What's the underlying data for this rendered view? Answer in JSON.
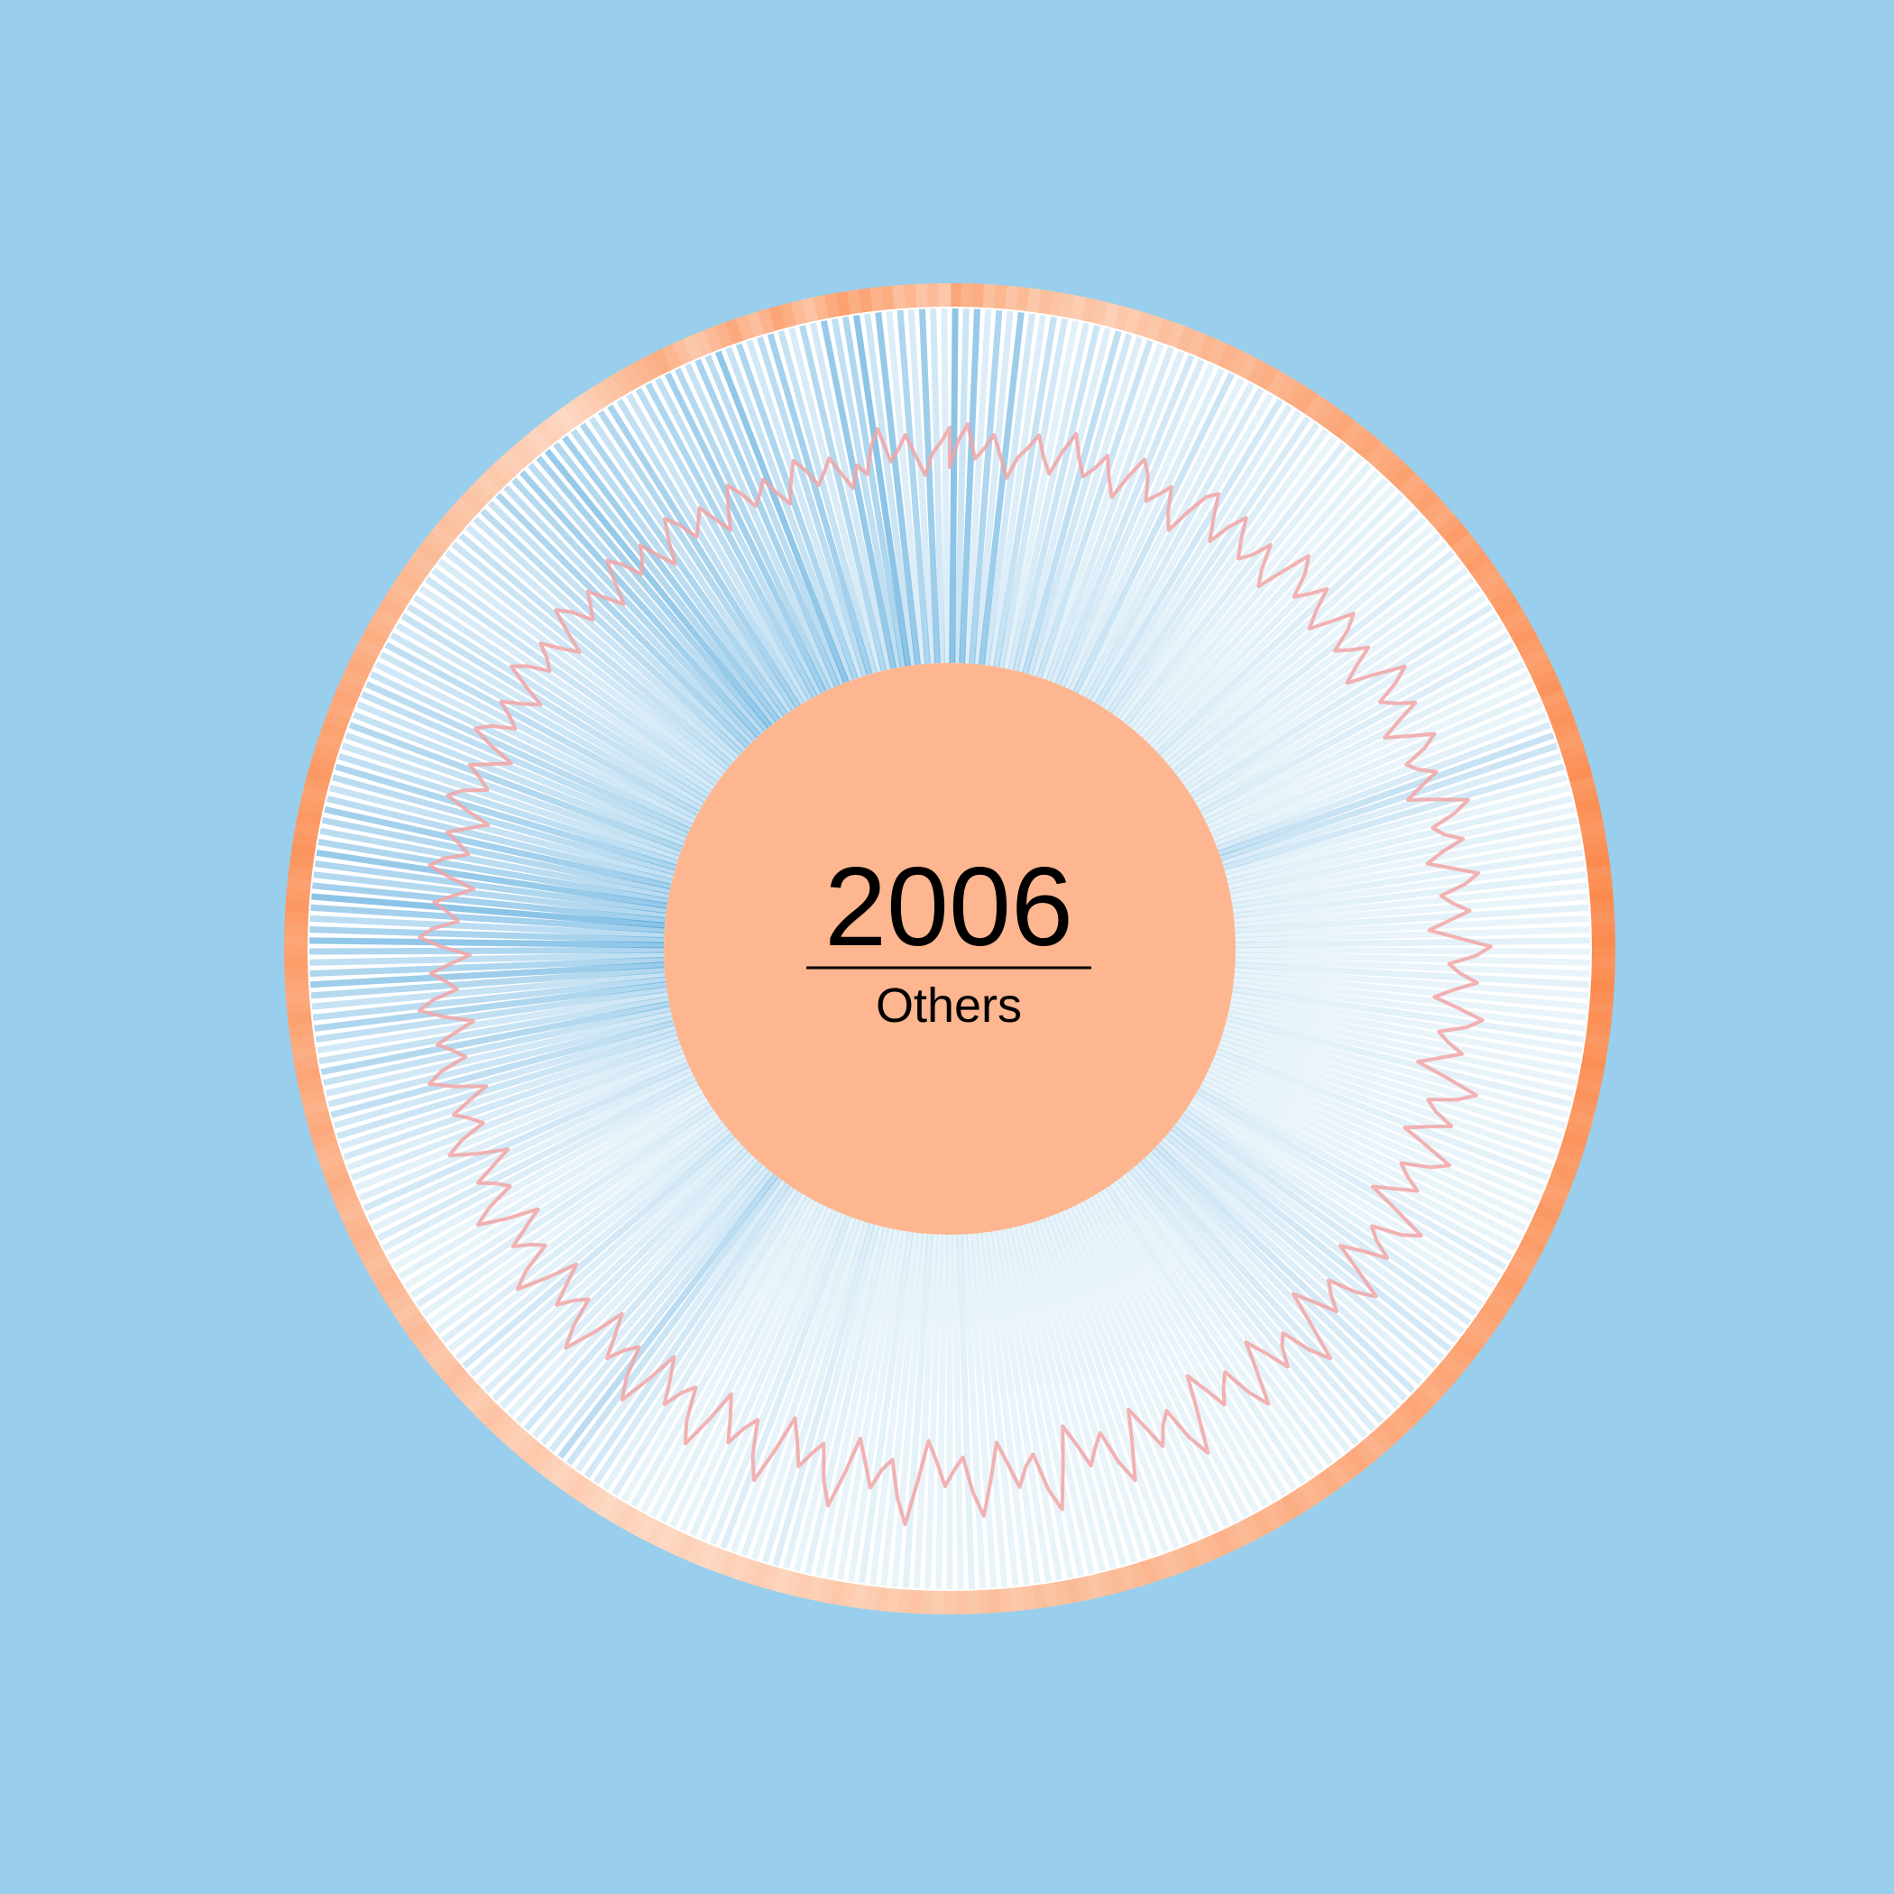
{
  "center": {
    "year": "2006",
    "category": "Others"
  },
  "colors": {
    "background": "#99cfec",
    "disc": "#ffffff",
    "center_disc": "#fdb68f",
    "outer_ring_light": "#fde2d1",
    "outer_ring_dark": "#fb8b4f",
    "spoke": "#3b9bd6",
    "line": "#f2a5a5"
  },
  "chart_data": {
    "type": "radial",
    "period_count": 365,
    "series": [
      {
        "mark": "line",
        "description_values_relative": true,
        "values": [
          0.47,
          0.62,
          0.71,
          0.52,
          0.58,
          0.66,
          0.54,
          0.43,
          0.55,
          0.61,
          0.69,
          0.57,
          0.49,
          0.63,
          0.74,
          0.61,
          0.52,
          0.58,
          0.67,
          0.55,
          0.46,
          0.6,
          0.72,
          0.65,
          0.51,
          0.57,
          0.64,
          0.5,
          0.42,
          0.56,
          0.68,
          0.73,
          0.59,
          0.48,
          0.61,
          0.7,
          0.58,
          0.49,
          0.55,
          0.66,
          0.52,
          0.44,
          0.59,
          0.75,
          0.67,
          0.53,
          0.6,
          0.69,
          0.56,
          0.47,
          0.58,
          0.71,
          0.63,
          0.5,
          0.57,
          0.66,
          0.54,
          0.45,
          0.61,
          0.77,
          0.68,
          0.55,
          0.62,
          0.72,
          0.59,
          0.48,
          0.6,
          0.74,
          0.66,
          0.53,
          0.58,
          0.67,
          0.56,
          0.47,
          0.63,
          0.79,
          0.7,
          0.56,
          0.61,
          0.71,
          0.58,
          0.49,
          0.62,
          0.76,
          0.68,
          0.54,
          0.6,
          0.69,
          0.57,
          0.46,
          0.62,
          0.8,
          0.72,
          0.57,
          0.63,
          0.73,
          0.6,
          0.5,
          0.64,
          0.78,
          0.7,
          0.55,
          0.61,
          0.7,
          0.58,
          0.47,
          0.65,
          0.83,
          0.74,
          0.58,
          0.64,
          0.75,
          0.62,
          0.51,
          0.66,
          0.82,
          0.73,
          0.57,
          0.63,
          0.72,
          0.6,
          0.49,
          0.67,
          0.86,
          0.77,
          0.6,
          0.66,
          0.77,
          0.63,
          0.52,
          0.68,
          0.85,
          0.75,
          0.59,
          0.65,
          0.74,
          0.61,
          0.5,
          0.69,
          0.9,
          0.79,
          0.62,
          0.67,
          0.78,
          0.64,
          0.53,
          0.7,
          0.88,
          0.77,
          0.6,
          0.66,
          0.75,
          0.62,
          0.51,
          0.72,
          0.94,
          0.82,
          0.63,
          0.69,
          0.8,
          0.66,
          0.54,
          0.73,
          0.92,
          0.8,
          0.61,
          0.68,
          0.77,
          0.63,
          0.52,
          0.74,
          0.97,
          0.85,
          0.64,
          0.7,
          0.81,
          0.67,
          0.55,
          0.75,
          0.95,
          0.82,
          0.62,
          0.69,
          0.78,
          0.64,
          0.53,
          0.76,
          1.0,
          0.86,
          0.65,
          0.71,
          0.82,
          0.68,
          0.56,
          0.77,
          0.96,
          0.83,
          0.63,
          0.7,
          0.79,
          0.65,
          0.54,
          0.75,
          0.94,
          0.82,
          0.62,
          0.69,
          0.8,
          0.66,
          0.55,
          0.74,
          0.91,
          0.8,
          0.61,
          0.67,
          0.78,
          0.64,
          0.53,
          0.72,
          0.89,
          0.78,
          0.6,
          0.66,
          0.76,
          0.63,
          0.52,
          0.71,
          0.87,
          0.76,
          0.59,
          0.65,
          0.74,
          0.62,
          0.51,
          0.69,
          0.85,
          0.75,
          0.58,
          0.64,
          0.73,
          0.61,
          0.5,
          0.68,
          0.83,
          0.73,
          0.57,
          0.63,
          0.72,
          0.6,
          0.49,
          0.66,
          0.8,
          0.71,
          0.56,
          0.62,
          0.7,
          0.59,
          0.48,
          0.65,
          0.78,
          0.7,
          0.55,
          0.61,
          0.69,
          0.58,
          0.47,
          0.63,
          0.76,
          0.68,
          0.54,
          0.6,
          0.68,
          0.57,
          0.46,
          0.62,
          0.74,
          0.67,
          0.53,
          0.59,
          0.67,
          0.56,
          0.46,
          0.6,
          0.72,
          0.65,
          0.52,
          0.58,
          0.66,
          0.55,
          0.45,
          0.59,
          0.71,
          0.64,
          0.51,
          0.57,
          0.65,
          0.54,
          0.44,
          0.58,
          0.7,
          0.63,
          0.5,
          0.56,
          0.64,
          0.53,
          0.44,
          0.57,
          0.69,
          0.62,
          0.5,
          0.55,
          0.63,
          0.52,
          0.43,
          0.56,
          0.68,
          0.61,
          0.49,
          0.55,
          0.62,
          0.52,
          0.43,
          0.55,
          0.67,
          0.6,
          0.49,
          0.54,
          0.62,
          0.51,
          0.42,
          0.55,
          0.66,
          0.59,
          0.48,
          0.54,
          0.61,
          0.51,
          0.42,
          0.54,
          0.65,
          0.58,
          0.48,
          0.53,
          0.6,
          0.5,
          0.42,
          0.54,
          0.64,
          0.57,
          0.47,
          0.53,
          0.6,
          0.5,
          0.41,
          0.53
        ]
      },
      {
        "mark": "spoke",
        "values": [
          0.9,
          0.35,
          0.8,
          0.2,
          0.6,
          0.25,
          0.75,
          0.3,
          0.2,
          0.4,
          0.3,
          0.15,
          0.25,
          0.35,
          0.2,
          0.45,
          0.3,
          0.2,
          0.35,
          0.15,
          0.25,
          0.2,
          0.3,
          0.25,
          0.15,
          0.2,
          0.35,
          0.15,
          0.2,
          0.25,
          0.15,
          0.3,
          0.2,
          0.15,
          0.25,
          0.2,
          0.15,
          0.1,
          0.2,
          0.15,
          0.1,
          0.15,
          0.1,
          0.15,
          0.1,
          0.15,
          0.1,
          0.2,
          0.15,
          0.1,
          0.15,
          0.1,
          0.2,
          0.1,
          0.15,
          0.1,
          0.15,
          0.1,
          0.2,
          0.15,
          0.1,
          0.15,
          0.2,
          0.1,
          0.15,
          0.1,
          0.1,
          0.15,
          0.1,
          0.15,
          0.25,
          0.4,
          0.35,
          0.2,
          0.3,
          0.15,
          0.1,
          0.15,
          0.1,
          0.15,
          0.1,
          0.1,
          0.15,
          0.1,
          0.15,
          0.1,
          0.1,
          0.15,
          0.1,
          0.1,
          0.15,
          0.1,
          0.1,
          0.1,
          0.15,
          0.1,
          0.1,
          0.1,
          0.1,
          0.15,
          0.1,
          0.1,
          0.1,
          0.1,
          0.1,
          0.15,
          0.1,
          0.1,
          0.1,
          0.1,
          0.1,
          0.1,
          0.15,
          0.1,
          0.1,
          0.1,
          0.1,
          0.1,
          0.1,
          0.1,
          0.15,
          0.2,
          0.15,
          0.1,
          0.1,
          0.15,
          0.2,
          0.25,
          0.15,
          0.2,
          0.3,
          0.2,
          0.25,
          0.15,
          0.2,
          0.3,
          0.25,
          0.2,
          0.15,
          0.25,
          0.2,
          0.15,
          0.2,
          0.15,
          0.1,
          0.15,
          0.1,
          0.1,
          0.15,
          0.1,
          0.1,
          0.1,
          0.1,
          0.1,
          0.1,
          0.1,
          0.1,
          0.1,
          0.1,
          0.1,
          0.1,
          0.1,
          0.1,
          0.1,
          0.1,
          0.1,
          0.1,
          0.1,
          0.1,
          0.1,
          0.1,
          0.1,
          0.1,
          0.1,
          0.1,
          0.1,
          0.1,
          0.1,
          0.1,
          0.1,
          0.15,
          0.1,
          0.1,
          0.1,
          0.1,
          0.1,
          0.15,
          0.1,
          0.1,
          0.1,
          0.15,
          0.1,
          0.1,
          0.1,
          0.1,
          0.15,
          0.1,
          0.15,
          0.2,
          0.15,
          0.1,
          0.15,
          0.1,
          0.2,
          0.15,
          0.1,
          0.15,
          0.1,
          0.1,
          0.15,
          0.1,
          0.1,
          0.15,
          0.1,
          0.2,
          0.15,
          0.25,
          0.3,
          0.2,
          0.35,
          0.5,
          0.3,
          0.25,
          0.2,
          0.3,
          0.2,
          0.15,
          0.2,
          0.25,
          0.2,
          0.15,
          0.2,
          0.3,
          0.2,
          0.15,
          0.2,
          0.15,
          0.1,
          0.15,
          0.2,
          0.15,
          0.1,
          0.15,
          0.1,
          0.15,
          0.2,
          0.25,
          0.15,
          0.2,
          0.3,
          0.2,
          0.15,
          0.25,
          0.2,
          0.3,
          0.25,
          0.35,
          0.3,
          0.45,
          0.35,
          0.3,
          0.4,
          0.55,
          0.4,
          0.3,
          0.45,
          0.6,
          0.5,
          0.4,
          0.55,
          0.75,
          0.6,
          0.45,
          0.6,
          0.85,
          0.65,
          0.5,
          0.7,
          0.9,
          0.7,
          0.55,
          0.6,
          0.8,
          0.6,
          0.5,
          0.55,
          0.7,
          0.5,
          0.4,
          0.5,
          0.6,
          0.45,
          0.35,
          0.4,
          0.55,
          0.4,
          0.35,
          0.45,
          0.5,
          0.4,
          0.3,
          0.35,
          0.45,
          0.35,
          0.3,
          0.4,
          0.35,
          0.3,
          0.25,
          0.35,
          0.3,
          0.25,
          0.3,
          0.35,
          0.4,
          0.3,
          0.35,
          0.5,
          0.4,
          0.6,
          0.45,
          0.55,
          0.7,
          0.5,
          0.65,
          0.8,
          0.55,
          0.7,
          0.5,
          0.6,
          0.4,
          0.55,
          0.65,
          0.45,
          0.35,
          0.5,
          0.6,
          0.45,
          0.7,
          0.55,
          0.4,
          0.65,
          0.5,
          0.85,
          0.4,
          0.6,
          0.3,
          0.5,
          0.7,
          0.4,
          0.25,
          0.55,
          0.3,
          0.8,
          0.45,
          0.6
        ]
      },
      {
        "mark": "ring",
        "values": [
          0.7,
          0.55,
          0.6,
          0.4,
          0.5,
          0.35,
          0.45,
          0.3,
          0.4,
          0.35,
          0.3,
          0.25,
          0.35,
          0.3,
          0.2,
          0.3,
          0.25,
          0.35,
          0.3,
          0.4,
          0.35,
          0.45,
          0.4,
          0.5,
          0.45,
          0.55,
          0.5,
          0.45,
          0.55,
          0.6,
          0.5,
          0.55,
          0.6,
          0.65,
          0.55,
          0.6,
          0.65,
          0.7,
          0.6,
          0.65,
          0.7,
          0.6,
          0.65,
          0.7,
          0.75,
          0.65,
          0.7,
          0.75,
          0.7,
          0.65,
          0.75,
          0.8,
          0.7,
          0.75,
          0.8,
          0.75,
          0.7,
          0.75,
          0.8,
          0.85,
          0.75,
          0.8,
          0.85,
          0.8,
          0.75,
          0.8,
          0.85,
          0.9,
          0.8,
          0.85,
          0.9,
          0.85,
          0.8,
          0.85,
          0.9,
          0.95,
          0.85,
          0.9,
          0.95,
          0.9,
          0.85,
          0.9,
          0.95,
          1.0,
          0.9,
          0.95,
          1.0,
          0.95,
          0.9,
          0.95,
          1.0,
          0.95,
          0.9,
          0.95,
          1.0,
          0.95,
          0.9,
          0.95,
          0.9,
          0.85,
          0.9,
          0.95,
          0.9,
          0.85,
          0.9,
          0.85,
          0.8,
          0.85,
          0.9,
          0.85,
          0.8,
          0.85,
          0.8,
          0.75,
          0.8,
          0.85,
          0.8,
          0.75,
          0.8,
          0.75,
          0.7,
          0.75,
          0.8,
          0.75,
          0.7,
          0.75,
          0.7,
          0.65,
          0.7,
          0.75,
          0.7,
          0.65,
          0.7,
          0.65,
          0.6,
          0.65,
          0.7,
          0.65,
          0.6,
          0.65,
          0.6,
          0.55,
          0.6,
          0.65,
          0.6,
          0.55,
          0.6,
          0.55,
          0.5,
          0.55,
          0.6,
          0.55,
          0.5,
          0.55,
          0.5,
          0.45,
          0.5,
          0.55,
          0.5,
          0.45,
          0.5,
          0.45,
          0.4,
          0.45,
          0.5,
          0.45,
          0.4,
          0.45,
          0.4,
          0.35,
          0.4,
          0.45,
          0.4,
          0.35,
          0.4,
          0.35,
          0.3,
          0.35,
          0.4,
          0.35,
          0.3,
          0.35,
          0.3,
          0.25,
          0.3,
          0.35,
          0.3,
          0.25,
          0.3,
          0.25,
          0.2,
          0.25,
          0.3,
          0.25,
          0.2,
          0.25,
          0.2,
          0.15,
          0.2,
          0.25,
          0.2,
          0.15,
          0.2,
          0.15,
          0.1,
          0.15,
          0.2,
          0.15,
          0.1,
          0.15,
          0.1,
          0.15,
          0.2,
          0.15,
          0.1,
          0.15,
          0.2,
          0.25,
          0.2,
          0.15,
          0.2,
          0.25,
          0.3,
          0.25,
          0.2,
          0.25,
          0.3,
          0.35,
          0.3,
          0.25,
          0.3,
          0.35,
          0.4,
          0.35,
          0.3,
          0.35,
          0.4,
          0.45,
          0.4,
          0.35,
          0.4,
          0.45,
          0.5,
          0.45,
          0.4,
          0.45,
          0.5,
          0.55,
          0.5,
          0.45,
          0.5,
          0.55,
          0.6,
          0.55,
          0.5,
          0.55,
          0.6,
          0.65,
          0.6,
          0.55,
          0.6,
          0.65,
          0.7,
          0.65,
          0.6,
          0.65,
          0.7,
          0.75,
          0.7,
          0.65,
          0.7,
          0.75,
          0.8,
          0.75,
          0.7,
          0.75,
          0.8,
          0.85,
          0.8,
          0.75,
          0.8,
          0.85,
          0.9,
          0.85,
          0.8,
          0.85,
          0.8,
          0.75,
          0.8,
          0.85,
          0.8,
          0.75,
          0.7,
          0.75,
          0.7,
          0.65,
          0.7,
          0.65,
          0.6,
          0.65,
          0.6,
          0.55,
          0.6,
          0.55,
          0.5,
          0.55,
          0.5,
          0.45,
          0.5,
          0.45,
          0.4,
          0.45,
          0.4,
          0.35,
          0.4,
          0.35,
          0.3,
          0.35,
          0.3,
          0.25,
          0.3,
          0.25,
          0.2,
          0.25,
          0.2,
          0.15,
          0.2,
          0.15,
          0.1,
          0.15,
          0.2,
          0.25,
          0.3,
          0.35,
          0.4,
          0.45,
          0.5,
          0.55,
          0.6,
          0.5,
          0.4,
          0.3,
          0.35,
          0.45,
          0.55,
          0.65,
          0.5,
          0.4,
          0.55,
          0.7,
          0.6,
          0.45,
          0.35,
          0.5,
          0.65,
          0.75,
          0.6
        ]
      }
    ]
  }
}
